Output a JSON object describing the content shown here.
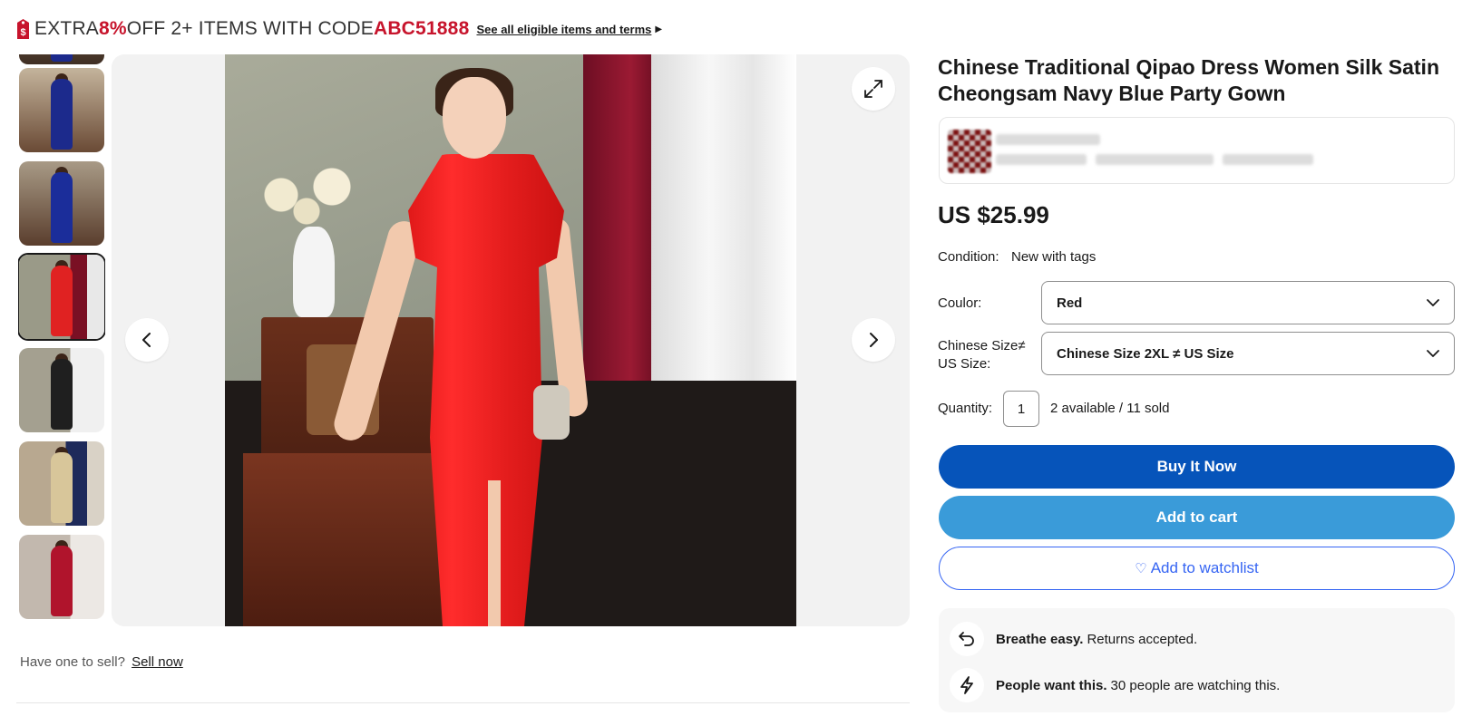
{
  "promo": {
    "prefix": "EXTRA ",
    "percent": "8%",
    "middle": " OFF 2+ ITEMS WITH CODE ",
    "code": "ABC51888",
    "terms_link": "See all eligible items and terms",
    "tag_icon": "price-tag-icon"
  },
  "thumbnails": [
    {
      "color": "#1c2a8c",
      "bg": "#b49b7a",
      "label": "navy-qipao-1"
    },
    {
      "color": "#1b2d9a",
      "bg": "#8d7c66",
      "label": "navy-qipao-2"
    },
    {
      "color": "#e02222",
      "bg": "#8a6e58",
      "label": "red-qipao",
      "selected": true
    },
    {
      "color": "#1f1f1f",
      "bg": "#9c8a78",
      "label": "black-qipao"
    },
    {
      "color": "#d8c69a",
      "bg": "#7a5a44",
      "label": "gold-qipao"
    },
    {
      "color": "#b0142c",
      "bg": "#c8c0b8",
      "label": "wine-qipao"
    }
  ],
  "gallery": {
    "expand_icon": "expand-icon",
    "prev_icon": "chevron-left-icon",
    "next_icon": "chevron-right-icon"
  },
  "sell": {
    "question": "Have one to sell?",
    "link": "Sell now"
  },
  "product": {
    "title": "Chinese Traditional Qipao Dress Women Silk Satin Cheongsam Navy Blue Party Gown",
    "price": "US $25.99",
    "condition_label": "Condition:",
    "condition_value": "New with tags",
    "color_label": "Coulor:",
    "color_value": "Red",
    "size_label": "Chinese Size≠ US Size:",
    "size_value": "Chinese Size 2XL ≠ US Size",
    "quantity_label": "Quantity:",
    "quantity_value": "1",
    "availability": "2 available / 11 sold"
  },
  "actions": {
    "buy_now": "Buy It Now",
    "add_to_cart": "Add to cart",
    "watchlist": "Add to watchlist"
  },
  "info": {
    "returns_bold": "Breathe easy.",
    "returns_text": "Returns accepted.",
    "watch_bold": "People want this.",
    "watch_text": "30 people are watching this."
  },
  "colors": {
    "accent_red": "#c7142c",
    "buy_blue": "#0654ba",
    "cart_blue": "#3a9bd9",
    "link_blue": "#3665f3"
  }
}
